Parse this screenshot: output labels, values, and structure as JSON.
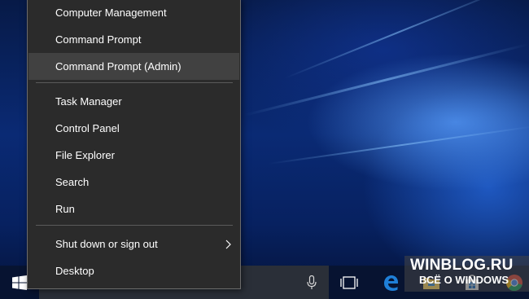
{
  "menu": {
    "items": [
      {
        "label": "Computer Management",
        "name": "menu-item-computer-management"
      },
      {
        "label": "Command Prompt",
        "name": "menu-item-command-prompt"
      },
      {
        "label": "Command Prompt (Admin)",
        "name": "menu-item-command-prompt-admin",
        "highlighted": true
      },
      {
        "label": "Task Manager",
        "name": "menu-item-task-manager"
      },
      {
        "label": "Control Panel",
        "name": "menu-item-control-panel"
      },
      {
        "label": "File Explorer",
        "name": "menu-item-file-explorer"
      },
      {
        "label": "Search",
        "name": "menu-item-search"
      },
      {
        "label": "Run",
        "name": "menu-item-run"
      },
      {
        "label": "Shut down or sign out",
        "name": "menu-item-shut-down-or-sign-out",
        "has_submenu": true
      },
      {
        "label": "Desktop",
        "name": "menu-item-desktop"
      }
    ]
  },
  "taskbar": {
    "icons": [
      "windows-logo-icon",
      "microphone-icon",
      "task-view-icon",
      "edge-icon",
      "file-explorer-icon",
      "store-icon",
      "chrome-icon"
    ]
  },
  "watermark": {
    "title": "WINBLOG.RU",
    "subtitle": "ВСЁ О WINDOWS"
  },
  "colors": {
    "menu_bg": "#2b2b2b",
    "menu_hover": "#414141",
    "edge_blue": "#1f7fd8"
  }
}
